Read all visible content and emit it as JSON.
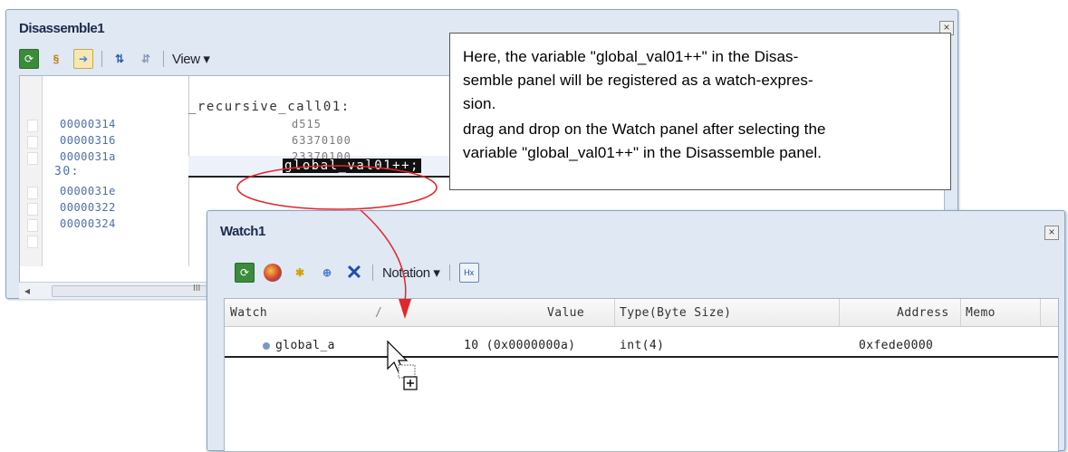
{
  "disassemble": {
    "title": "Disassemble1",
    "view_menu": "View ▾",
    "label": "_recursive_call01:",
    "source_line": "30:",
    "rows": [
      {
        "address": "00000314",
        "code": "d515"
      },
      {
        "address": "00000316",
        "code": "63370100"
      },
      {
        "address": "0000031a",
        "code": "23370100"
      },
      {
        "address": "0000031e",
        "code": ""
      },
      {
        "address": "00000322",
        "code": ""
      },
      {
        "address": "00000324",
        "code": ""
      }
    ],
    "selected_variable": "global_val01++;",
    "scroll_grip": "III"
  },
  "callout": {
    "line1": "Here, the variable \"global_val01++\" in the Disas-",
    "line2": "semble panel will be registered as a watch-expres-",
    "line3": "sion.",
    "line4": "drag and drop on the Watch panel after selecting the",
    "line5": "variable \"global_val01++\" in the Disassemble panel."
  },
  "watch": {
    "title": "Watch1",
    "notation_menu": "Notation ▾",
    "columns": {
      "watch": "Watch",
      "sort_mark": "/",
      "value": "Value",
      "type": "Type(Byte Size)",
      "address": "Address",
      "memo": "Memo"
    },
    "row": {
      "watch": "global_a",
      "value": "10 (0x0000000a)",
      "type": "int(4)",
      "address": "0xfede0000",
      "memo": ""
    }
  },
  "icons": {
    "close": "close-icon",
    "refresh": "refresh-icon",
    "delete": "delete-icon",
    "drag_cursor": "drag-copy-cursor-icon"
  },
  "colors": {
    "panel_bg": "#dfe8f3",
    "address": "#4d6fa8",
    "annotation": "#e2262b"
  }
}
